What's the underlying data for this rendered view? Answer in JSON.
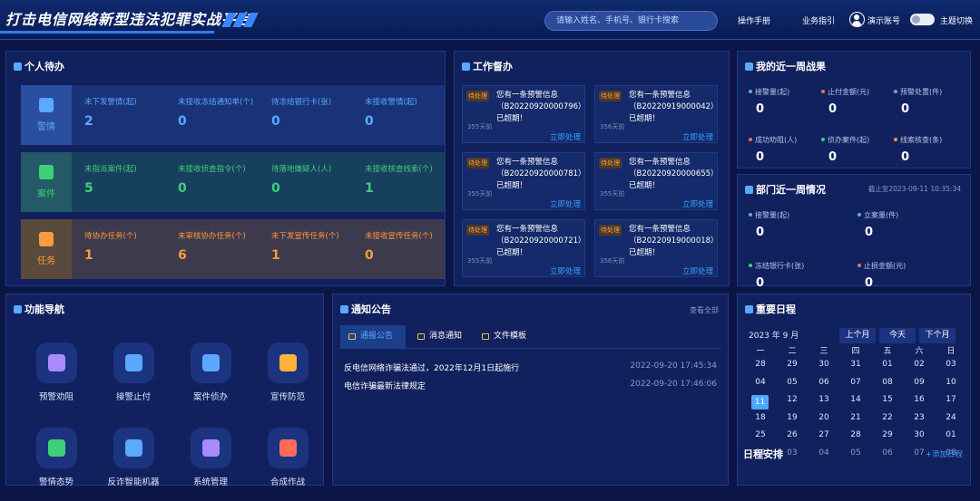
{
  "header": {
    "title": "打击电信网络新型违法犯罪实战平台",
    "search_placeholder": "请输入姓名、手机号、银行卡搜索",
    "manual": "操作手册",
    "guide": "业务指引",
    "account": "演示账号",
    "theme": "主题切换"
  },
  "todo": {
    "title": "个人待办",
    "rows": [
      {
        "label": "警情",
        "color": "#5aa8ff",
        "items": [
          {
            "k": "未下发警情(起)",
            "v": "2"
          },
          {
            "k": "未接收冻结通知单(个)",
            "v": "0"
          },
          {
            "k": "待冻结银行卡(张)",
            "v": "0"
          },
          {
            "k": "未接收警情(起)",
            "v": "0"
          }
        ]
      },
      {
        "label": "案件",
        "color": "#3fcf77",
        "items": [
          {
            "k": "未指派案件(起)",
            "v": "5"
          },
          {
            "k": "未接收侦查指令(个)",
            "v": "0"
          },
          {
            "k": "待落地嫌疑人(人)",
            "v": "0"
          },
          {
            "k": "未接收核查线索(个)",
            "v": "1"
          }
        ]
      },
      {
        "label": "任务",
        "color": "#ff9a3c",
        "items": [
          {
            "k": "待协办任务(个)",
            "v": "1"
          },
          {
            "k": "未审核协办任务(个)",
            "v": "6"
          },
          {
            "k": "未下发宣传任务(个)",
            "v": "1"
          },
          {
            "k": "未接收宣传任务(个)",
            "v": "0"
          }
        ]
      }
    ]
  },
  "work": {
    "title": "工作督办",
    "tag": "待处理",
    "action": "立即处理",
    "cards": [
      {
        "text": "您有一条预警信息（B20220920000796）已超期！",
        "time": "355天前"
      },
      {
        "text": "您有一条预警信息（B20220919000042）已超期！",
        "time": "356天前"
      },
      {
        "text": "您有一条预警信息（B20220920000781）已超期！",
        "time": "355天前"
      },
      {
        "text": "您有一条预警信息（B20220920000655）已超期！",
        "time": "355天前"
      },
      {
        "text": "您有一条预警信息（B20220920000721）已超期！",
        "time": "355天前"
      },
      {
        "text": "您有一条预警信息（B20220919000018）已超期！",
        "time": "356天前"
      }
    ]
  },
  "weekly": {
    "title": "我的近一周战果",
    "items": [
      {
        "k": "接警量(起)",
        "v": "0",
        "c": "#5aa8ff"
      },
      {
        "k": "止付金额(元)",
        "v": "0",
        "c": "#ff6b5a"
      },
      {
        "k": "预警处置(件)",
        "v": "0",
        "c": "#5aa8ff"
      },
      {
        "k": "成功劝阻(人)",
        "v": "0",
        "c": "#ff6b5a"
      },
      {
        "k": "侦办案件(起)",
        "v": "0",
        "c": "#3fcf77"
      },
      {
        "k": "线索核查(条)",
        "v": "0",
        "c": "#ff9a3c"
      }
    ]
  },
  "dept": {
    "title": "部门近一周情况",
    "deadline": "截止至2023-09-11 10:35:34",
    "items": [
      {
        "k": "接警量(起)",
        "v": "0",
        "c": "#5aa8ff"
      },
      {
        "k": "立案量(件)",
        "v": "0",
        "c": "#5aa8ff"
      },
      {
        "k": "冻结银行卡(张)",
        "v": "0",
        "c": "#3fcf77"
      },
      {
        "k": "止损金额(元)",
        "v": "0",
        "c": "#ff6b5a"
      }
    ]
  },
  "nav": {
    "title": "功能导航",
    "items": [
      {
        "label": "预警劝阻",
        "c": "#a78bfa"
      },
      {
        "label": "接警止付",
        "c": "#5aa8ff"
      },
      {
        "label": "案件侦办",
        "c": "#5aa8ff"
      },
      {
        "label": "宣传防范",
        "c": "#ffb23c"
      },
      {
        "label": "警情态势",
        "c": "#3fcf77"
      },
      {
        "label": "反诈智能机器",
        "c": "#5aa8ff"
      },
      {
        "label": "系统管理",
        "c": "#a78bfa"
      },
      {
        "label": "合成作战",
        "c": "#ff6b5a"
      }
    ]
  },
  "notice": {
    "title": "通知公告",
    "view_all": "查看全部",
    "tabs": [
      "通报公告",
      "消息通知",
      "文件模板"
    ],
    "rows": [
      {
        "t": "反电信网络诈骗法通过，2022年12月1日起施行",
        "d": "2022-09-20 17:45:34"
      },
      {
        "t": "电信诈骗最新法律规定",
        "d": "2022-09-20 17:46:06"
      }
    ]
  },
  "schedule": {
    "title": "重要日程",
    "month": "2023 年 9 月",
    "prev": "上个月",
    "today": "今天",
    "next": "下个月",
    "weekdays": [
      "一",
      "二",
      "三",
      "四",
      "五",
      "六",
      "日"
    ],
    "weeks": [
      [
        "28",
        "29",
        "30",
        "31",
        "01",
        "02",
        "03"
      ],
      [
        "04",
        "05",
        "06",
        "07",
        "08",
        "09",
        "10"
      ],
      [
        "11",
        "12",
        "13",
        "14",
        "15",
        "16",
        "17"
      ],
      [
        "18",
        "19",
        "20",
        "21",
        "22",
        "23",
        "24"
      ],
      [
        "25",
        "26",
        "27",
        "28",
        "29",
        "30",
        "01"
      ],
      [
        "02",
        "03",
        "04",
        "05",
        "06",
        "07",
        "08"
      ]
    ],
    "today_date": "11",
    "agenda": "日程安排",
    "add": "+添加日程"
  }
}
